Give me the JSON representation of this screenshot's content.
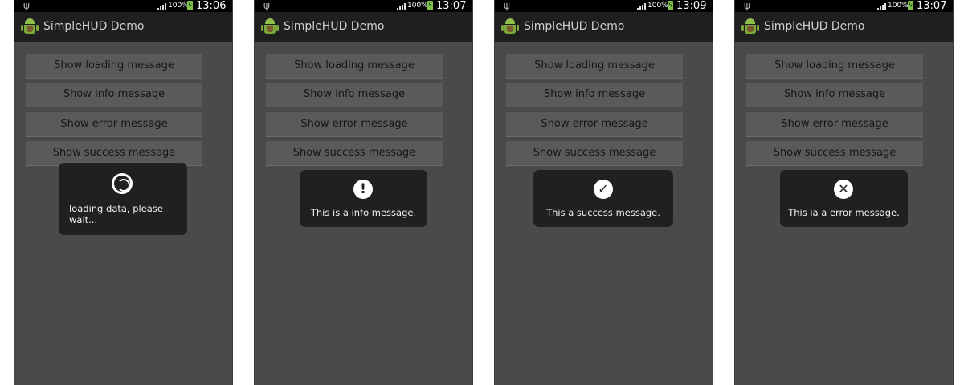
{
  "app_title": "SimpleHUD Demo",
  "battery_pct": "100%",
  "buttons": {
    "loading": "Show loading message",
    "info": "Show info message",
    "error": "Show error message",
    "success": "Show success message"
  },
  "screens": [
    {
      "clock": "13:06",
      "hud": {
        "type": "loading",
        "icon": "loading-spinner-icon",
        "line1": "loading data, please",
        "line2": "wait..."
      }
    },
    {
      "clock": "13:07",
      "hud": {
        "type": "info",
        "icon": "exclamation-icon",
        "message": "This is a info message."
      }
    },
    {
      "clock": "13:09",
      "hud": {
        "type": "success",
        "icon": "checkmark-icon",
        "message": "This a success message."
      }
    },
    {
      "clock": "13:07",
      "hud": {
        "type": "error",
        "icon": "close-x-icon",
        "message": "This ia a error message."
      }
    }
  ]
}
